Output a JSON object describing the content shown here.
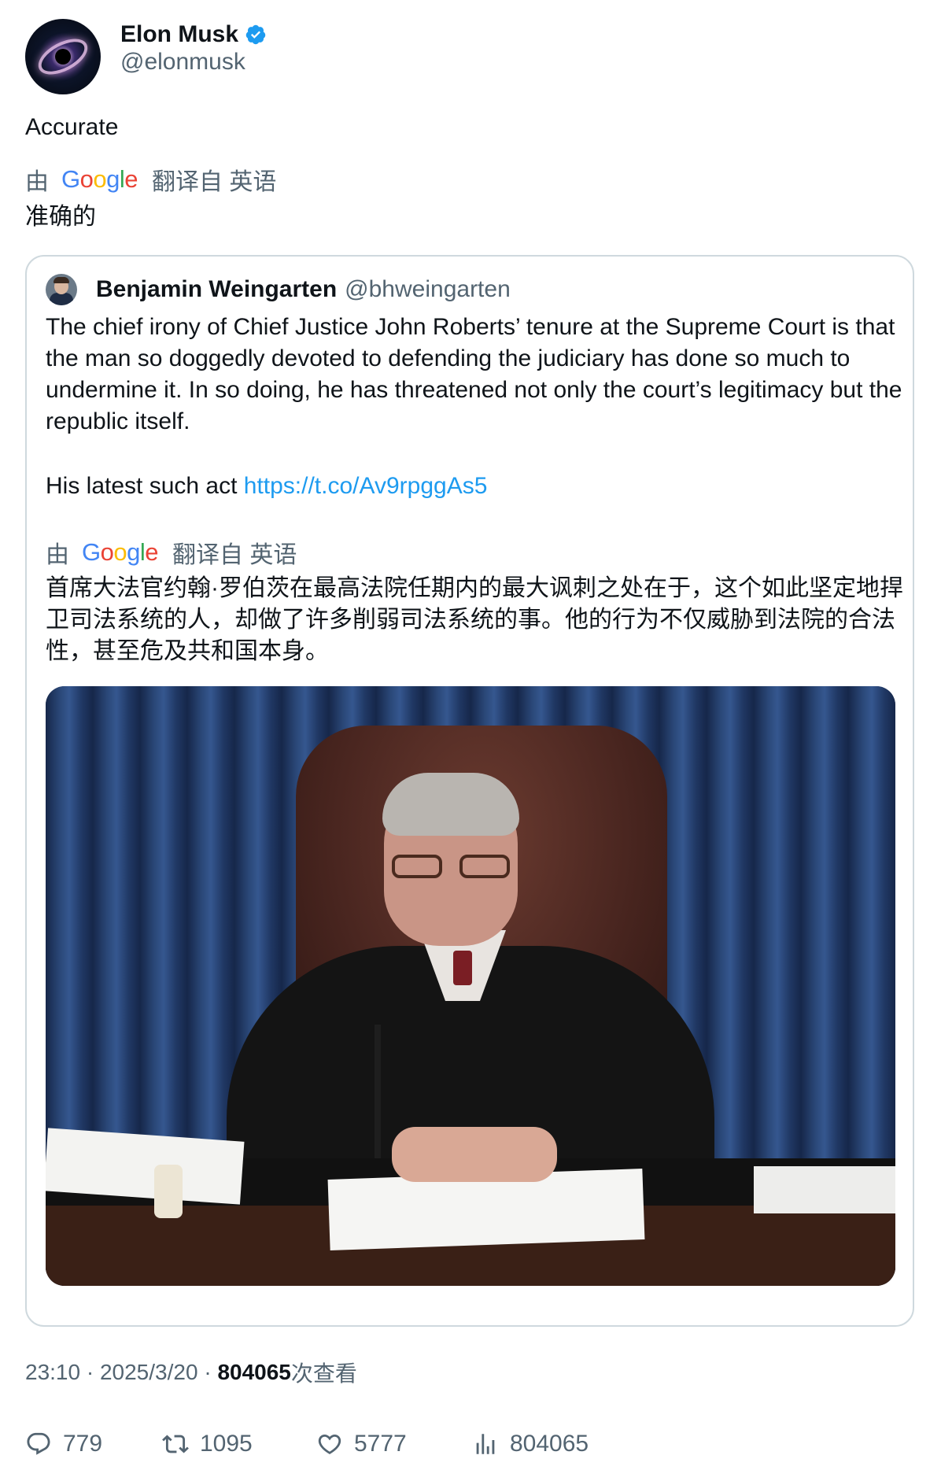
{
  "author": {
    "name": "Elon Musk",
    "handle": "@elonmusk",
    "verified_icon": "verified-badge-icon"
  },
  "tweet": {
    "text": "Accurate",
    "translation_by": "由",
    "translation_from": "翻译自 英语",
    "translated_text": "准确的"
  },
  "quote": {
    "name": "Benjamin Weingarten",
    "handle": "@bhweingarten",
    "text": "The chief irony of Chief Justice John Roberts’ tenure at the Supreme Court is that the man so doggedly devoted to defending the judiciary has done so much to undermine it. In so doing, he has threatened not only the court’s legitimacy but the republic itself.",
    "link_prefix": "His latest such act ",
    "link": "https://t.co/Av9rpggAs5",
    "translation_by": "由",
    "translation_from": "翻译自 英语",
    "translated_text": "首席大法官约翰·罗伯茨在最高法院任期内的最大讽刺之处在于，这个如此坚定地捍卫司法系统的人，却做了许多削弱司法系统的事。他的行为不仅威胁到法院的合法性，甚至危及共和国本身。"
  },
  "meta": {
    "time": "23:10",
    "sep1": " · ",
    "date": "2025/3/20",
    "sep2": " · ",
    "views_number": "804065",
    "views_label": "次查看"
  },
  "actions": {
    "replies": "779",
    "retweets": "1095",
    "likes": "5777",
    "views": "804065"
  },
  "colors": {
    "link": "#1d9bf0",
    "secondary_text": "#536471",
    "border": "#cfd9de"
  }
}
